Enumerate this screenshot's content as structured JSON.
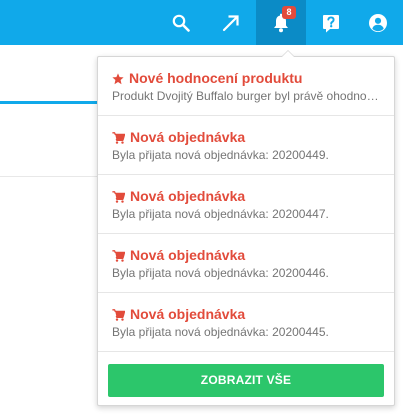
{
  "topbar": {
    "icons": [
      "search-icon",
      "external-link-icon",
      "bell-icon",
      "help-icon",
      "user-icon"
    ],
    "notification_count": "8",
    "colors": {
      "bar": "#10a9ea",
      "active": "#0b8bc6",
      "badge": "#e24b3b"
    }
  },
  "notifications": {
    "items": [
      {
        "icon": "star-icon",
        "title": "Nové hodnocení produktu",
        "description": "Produkt Dvojitý Buffalo burger byl právě ohodnocen"
      },
      {
        "icon": "cart-icon",
        "title": "Nová objednávka",
        "description": "Byla přijata nová objednávka: 20200449."
      },
      {
        "icon": "cart-icon",
        "title": "Nová objednávka",
        "description": "Byla přijata nová objednávka: 20200447."
      },
      {
        "icon": "cart-icon",
        "title": "Nová objednávka",
        "description": "Byla přijata nová objednávka: 20200446."
      },
      {
        "icon": "cart-icon",
        "title": "Nová objednávka",
        "description": "Byla přijata nová objednávka: 20200445."
      }
    ],
    "show_all_label": "ZOBRAZIT VŠE",
    "colors": {
      "title": "#e24b3b",
      "button": "#2cc66b"
    }
  }
}
